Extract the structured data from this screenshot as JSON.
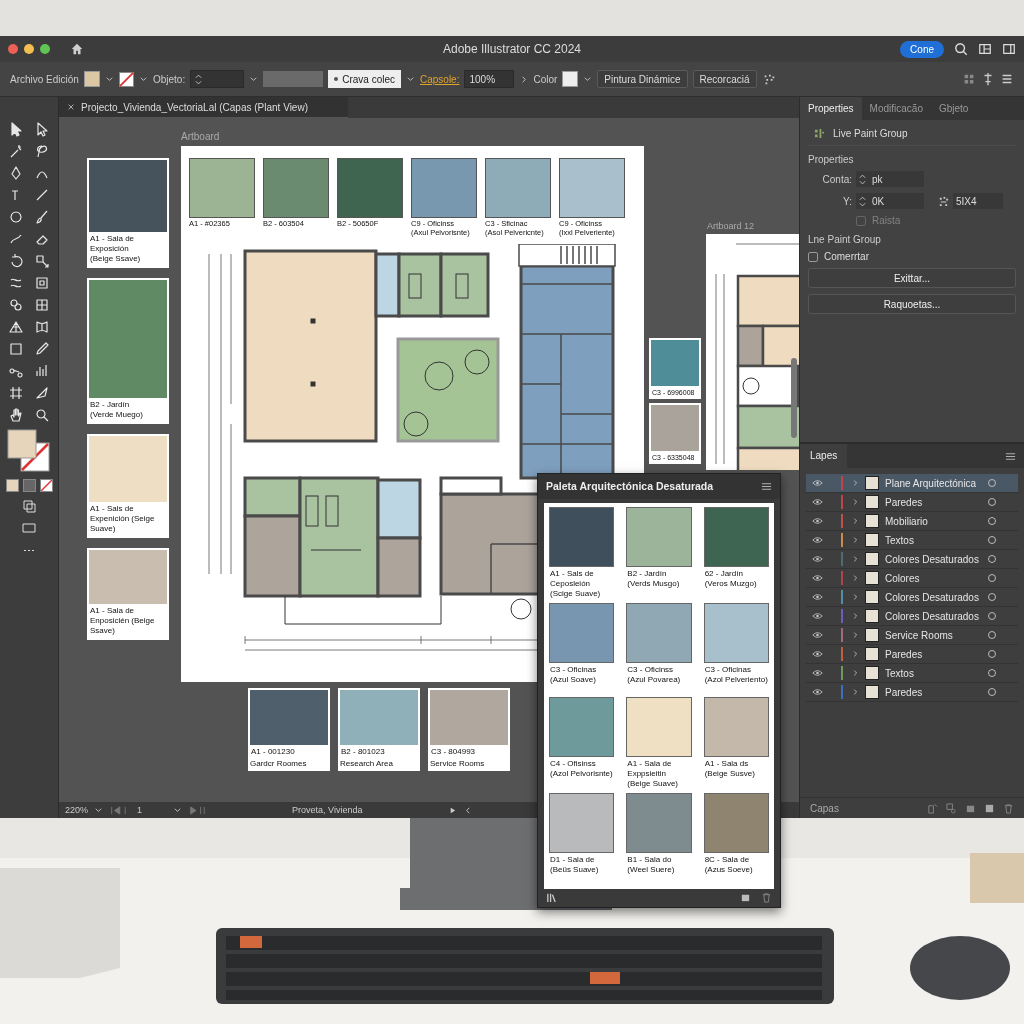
{
  "window": {
    "title": "Adobe Illustrator CC 2024",
    "share_button": "Cone"
  },
  "control_bar": {
    "menu": "Archivo Edición",
    "object_label": "Objeto:",
    "preset_button": "Crava colec",
    "capsule_link": "Capsole:",
    "opacity": "100%",
    "color_label": "Color",
    "buttons": [
      "Pintura Dinámice",
      "Recorcaciá"
    ]
  },
  "document_tab": {
    "title": "Projecto_Vivienda_VectoriaLal (Capas (Plant View)"
  },
  "canvas": {
    "artboard_label": "Artboard",
    "artboard_2_label": "Artboard 12",
    "left_swatches": [
      {
        "label": "A1 - Sala de\nExposición\n(Beige Ssave)",
        "color": "#46525c"
      },
      {
        "label": "B2 - Jardín\n(Verde Muego)",
        "color": "#5f8a63"
      },
      {
        "label": "A1 - Sals de\nExpenición (Seige\nSuave)",
        "color": "#eedfc4"
      },
      {
        "label": "A1 - Sala de\nEnposicién (Beige\nSsave)",
        "color": "#c9bdb0"
      }
    ],
    "top_swatches": [
      {
        "label": "A1 - #02365",
        "color": "#9cb394"
      },
      {
        "label": "B2 - 603504",
        "color": "#6b8b70"
      },
      {
        "label": "B2 - 50650F",
        "color": "#3f6450"
      },
      {
        "label": "C9 - Oficinss\n(Axul Pelvorisnte)",
        "color": "#7898b0"
      },
      {
        "label": "C3 - Sficinac\n(Asol Pelvericnte)",
        "color": "#8eabb8"
      },
      {
        "label": "C9 - Oficinss\n(Ixxl Pelveriente)",
        "color": "#a9bfcc"
      }
    ],
    "side_swatches": [
      {
        "label": "C3 - 6996008",
        "color": "#4f8e98"
      },
      {
        "label": "C3 - 6335048",
        "color": "#aaa39b"
      }
    ],
    "bottom_swatches": [
      {
        "label": "A1 - 001230\nGardcr Roomes",
        "color": "#4f5f6b"
      },
      {
        "label": "B2 - 801023\nResearch Area",
        "color": "#8fb0b8"
      },
      {
        "label": "C3 - 804993\nService Rooms",
        "color": "#b0a79e"
      }
    ]
  },
  "status_bar": {
    "zoom": "220%",
    "page": "1",
    "document": "Proveta, Vivienda"
  },
  "properties_panel": {
    "tabs": [
      {
        "label": "Properties",
        "selected": true
      },
      {
        "label": "Modificacão",
        "selected": false
      },
      {
        "label": "Gbjeto",
        "selected": false
      }
    ],
    "object_type": "Live Paint Group",
    "section_title": "Properties",
    "count": {
      "label": "Conta:",
      "value": "pk"
    },
    "y": {
      "label": "Y:",
      "value": "0K"
    },
    "size_value": "5IX4",
    "raista": {
      "label": "Raista",
      "checked": false,
      "disabled": true
    },
    "group_title": "Lne Paint Group",
    "comment": {
      "label": "Comerrtar",
      "checked": false,
      "disabled": false
    },
    "buttons": [
      "Exittar...",
      "Raquoetas..."
    ]
  },
  "layers_panel": {
    "tab": "Lapes",
    "footer": "Capas",
    "layers": [
      {
        "name": "Plane Arquitectónica",
        "color": "#c0444c",
        "selected": true
      },
      {
        "name": "Paredes",
        "color": "#c0444c",
        "selected": false
      },
      {
        "name": "Mobiliario",
        "color": "#c0504a",
        "selected": false
      },
      {
        "name": "Textos",
        "color": "#c98a4c",
        "selected": false
      },
      {
        "name": "Colores Desaturados",
        "color": "#4d6b70",
        "selected": false
      },
      {
        "name": "Colores",
        "color": "#b0444c",
        "selected": false
      },
      {
        "name": "Colores Desaturados",
        "color": "#4f8fa8",
        "selected": false
      },
      {
        "name": "Colores Desaturados",
        "color": "#6a5fc0",
        "selected": false
      },
      {
        "name": "Service Rooms",
        "color": "#a06a80",
        "selected": false
      },
      {
        "name": "Paredes",
        "color": "#c0603c",
        "selected": false
      },
      {
        "name": "Textos",
        "color": "#6f9a5c",
        "selected": false
      },
      {
        "name": "Paredes",
        "color": "#3f6fc0",
        "selected": false
      }
    ]
  },
  "palette_panel": {
    "title": "Paleta Arquitectónica Desaturada",
    "swatches": [
      {
        "label": "A1 - Sals de\nCeposleión\n(Scige Suave)",
        "color": "#3f4f5b"
      },
      {
        "label": "B2 - Jardín\n(Verds Musgo)",
        "color": "#9cb59a"
      },
      {
        "label": "62 - Jardín\n(Veros Muzgo)",
        "color": "#3d6552"
      },
      {
        "label": "C3 - Oficinas\n(Azul Soave)",
        "color": "#7896b0"
      },
      {
        "label": "C3 - Oficinss\n(Azul Povarea)",
        "color": "#8fa8b4"
      },
      {
        "label": "C3 - Oficinas\n(Azol Pelveriento)",
        "color": "#a8bfcc"
      },
      {
        "label": "C4 - Ofisinss\n(Azol Pelvorisnte)",
        "color": "#6e9a9c"
      },
      {
        "label": "A1 - Sala de\nExppsieitin\n(Beige Suave)",
        "color": "#efe0c4"
      },
      {
        "label": "A1 - Sala ds\n(Beige Susve)",
        "color": "#c4b8aa"
      },
      {
        "label": "D1 - Sala de\n(Beüs Suave)",
        "color": "#b8babb"
      },
      {
        "label": "B1 - Sala do\n(Weel Suere)",
        "color": "#7f8c8f"
      },
      {
        "label": "8C - Sala de\n(Azus Soeve)",
        "color": "#8f8470"
      }
    ]
  }
}
